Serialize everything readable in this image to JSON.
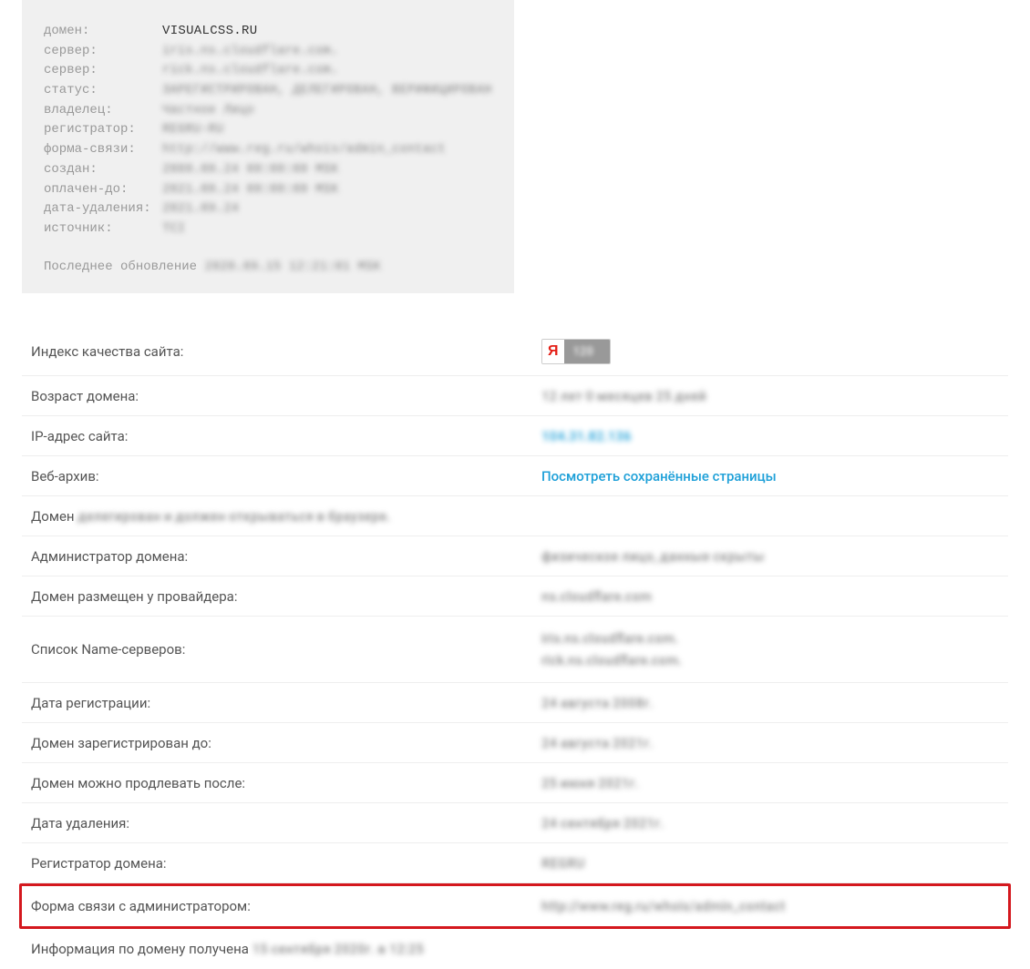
{
  "whois": {
    "rows": [
      {
        "label": "домен:",
        "value": "VISUALCSS.RU",
        "clear": true
      },
      {
        "label": "сервер:",
        "value": "iris.ns.cloudflare.com."
      },
      {
        "label": "сервер:",
        "value": "rick.ns.cloudflare.com."
      },
      {
        "label": "статус:",
        "value": "ЗАРЕГИСТРИРОВАН, ДЕЛЕГИРОВАН, ВЕРИФИЦИРОВАН"
      },
      {
        "label": "владелец:",
        "value": "Частное Лицо"
      },
      {
        "label": "регистратор:",
        "value": "REGRU-RU"
      },
      {
        "label": "форма-связи:",
        "value": "http://www.reg.ru/whois/admin_contact"
      },
      {
        "label": "создан:",
        "value": "2008.08.24 00:00:00 MSK"
      },
      {
        "label": "оплачен-до:",
        "value": "2021.08.24 00:00:00 MSK"
      },
      {
        "label": "дата-удаления:",
        "value": "2021.09.24"
      },
      {
        "label": "источник:",
        "value": "TCI"
      }
    ],
    "update_label": "Последнее обновление",
    "update_value": " 2020.09.15 12:21:01 MSK"
  },
  "yandex": {
    "letter": "Я",
    "score": "120"
  },
  "details": {
    "site_quality_label": "Индекс качества сайта:",
    "domain_age_label": "Возраст домена:",
    "domain_age_value": "12 лет 0 месяцев 25 дней",
    "ip_label": "IP-адрес сайта:",
    "ip_value": "104.31.82.136",
    "web_archive_label": "Веб-архив:",
    "web_archive_link": "Посмотреть сохранённые страницы",
    "domain_status_prefix": "Домен ",
    "domain_status_blur": "делегирован и должен открываться в браузере.",
    "admin_label": "Администратор домена:",
    "admin_value": "физическое лицо, данные скрыты",
    "provider_label": "Домен размещен у провайдера:",
    "provider_value": "ns.cloudflare.com",
    "ns_label": "Список Name-серверов:",
    "ns_value_1": "iris.ns.cloudflare.com.",
    "ns_value_2": "rick.ns.cloudflare.com.",
    "reg_date_label": "Дата регистрации:",
    "reg_date_value": "24 августа 2008г.",
    "reg_until_label": "Домен зарегистрирован до:",
    "reg_until_value": "24 августа 2021г.",
    "renew_after_label": "Домен можно продлевать после:",
    "renew_after_value": "25 июня 2021г.",
    "delete_date_label": "Дата удаления:",
    "delete_date_value": "24 сентября 2021г.",
    "registrar_label": "Регистратор домена:",
    "registrar_value": "REGRU",
    "contact_form_label": "Форма связи с администратором:",
    "contact_form_value": "http://www.reg.ru/whois/admin_contact",
    "info_received_prefix": "Информация по домену получена ",
    "info_received_value": "15 сентября 2020г. в 12:25"
  }
}
